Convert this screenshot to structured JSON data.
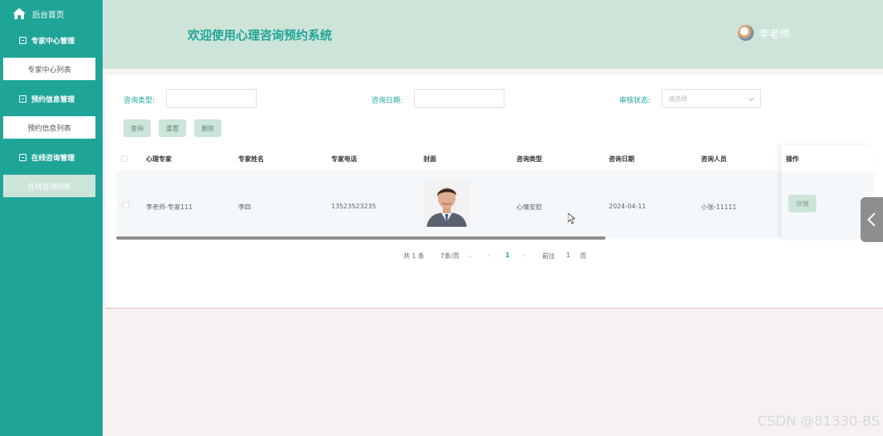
{
  "sidebar": {
    "home": "后台首页",
    "groups": [
      {
        "label": "专家中心管理",
        "items": [
          "专家中心列表"
        ]
      },
      {
        "label": "预约信息管理",
        "items": [
          "预约信息列表"
        ]
      },
      {
        "label": "在线咨询管理",
        "items": [
          "在线咨询列表"
        ]
      }
    ]
  },
  "header": {
    "title": "欢迎使用心理咨询预约系统",
    "user": "李老师"
  },
  "filters": {
    "type_label": "咨询类型:",
    "date_label": "咨询日期:",
    "status_label": "审核状态:",
    "status_placeholder": "请选择"
  },
  "buttons": {
    "query": "查询",
    "reset": "重置",
    "delete": "删除"
  },
  "table": {
    "headers": [
      "心理专家",
      "专家姓名",
      "专家电话",
      "封面",
      "咨询类型",
      "咨询日期",
      "咨询人员",
      "操作"
    ],
    "rows": [
      {
        "expert": "李老师-专家111",
        "name": "李四",
        "phone": "13523523235",
        "type": "心情安慰",
        "date": "2024-04-11",
        "person": "小张-11111",
        "action": "详情"
      }
    ]
  },
  "pagination": {
    "total": "共 1 条",
    "page_size": "7条/页",
    "current": "1",
    "goto_label": "前往",
    "goto_value": "1",
    "page_suffix": "页"
  },
  "watermark": "CSDN @81330-BS",
  "colors": {
    "primary": "#1fa598",
    "header_bg": "#cde4d9"
  }
}
